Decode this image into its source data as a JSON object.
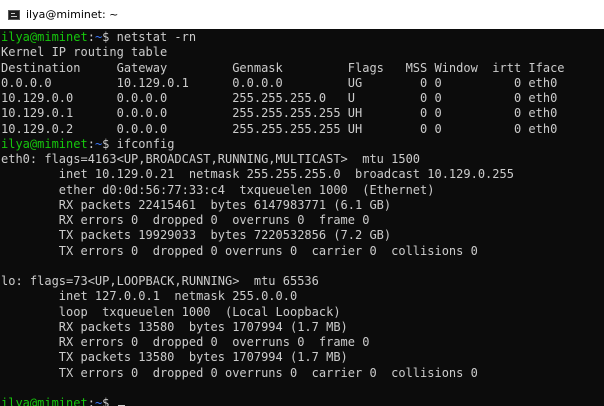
{
  "window": {
    "title": "ilya@miminet: ~",
    "icon": "terminal-icon"
  },
  "colors": {
    "background": "#0c0c0c",
    "text": "#cccccc",
    "prompt_user": "#16c60c",
    "prompt_path": "#3b78ff"
  },
  "prompt": {
    "user_host": "ilya@miminet",
    "colon": ":",
    "path": "~",
    "symbol": "$ "
  },
  "commands": {
    "netstat": "netstat -rn",
    "ifconfig": "ifconfig",
    "last": ""
  },
  "output": {
    "netstat_lines": [
      "Kernel IP routing table",
      "Destination     Gateway         Genmask         Flags   MSS Window  irtt Iface",
      "0.0.0.0         10.129.0.1      0.0.0.0         UG        0 0          0 eth0",
      "10.129.0.0      0.0.0.0         255.255.255.0   U         0 0          0 eth0",
      "10.129.0.1      0.0.0.0         255.255.255.255 UH        0 0          0 eth0",
      "10.129.0.2      0.0.0.0         255.255.255.255 UH        0 0          0 eth0"
    ],
    "ifconfig_lines": [
      "eth0: flags=4163<UP,BROADCAST,RUNNING,MULTICAST>  mtu 1500",
      "        inet 10.129.0.21  netmask 255.255.255.0  broadcast 10.129.0.255",
      "        ether d0:0d:56:77:33:c4  txqueuelen 1000  (Ethernet)",
      "        RX packets 22415461  bytes 6147983771 (6.1 GB)",
      "        RX errors 0  dropped 0  overruns 0  frame 0",
      "        TX packets 19929033  bytes 7220532856 (7.2 GB)",
      "        TX errors 0  dropped 0 overruns 0  carrier 0  collisions 0",
      "",
      "lo: flags=73<UP,LOOPBACK,RUNNING>  mtu 65536",
      "        inet 127.0.0.1  netmask 255.0.0.0",
      "        loop  txqueuelen 1000  (Local Loopback)",
      "        RX packets 13580  bytes 1707994 (1.7 MB)",
      "        RX errors 0  dropped 0  overruns 0  frame 0",
      "        TX packets 13580  bytes 1707994 (1.7 MB)",
      "        TX errors 0  dropped 0 overruns 0  carrier 0  collisions 0",
      ""
    ]
  }
}
